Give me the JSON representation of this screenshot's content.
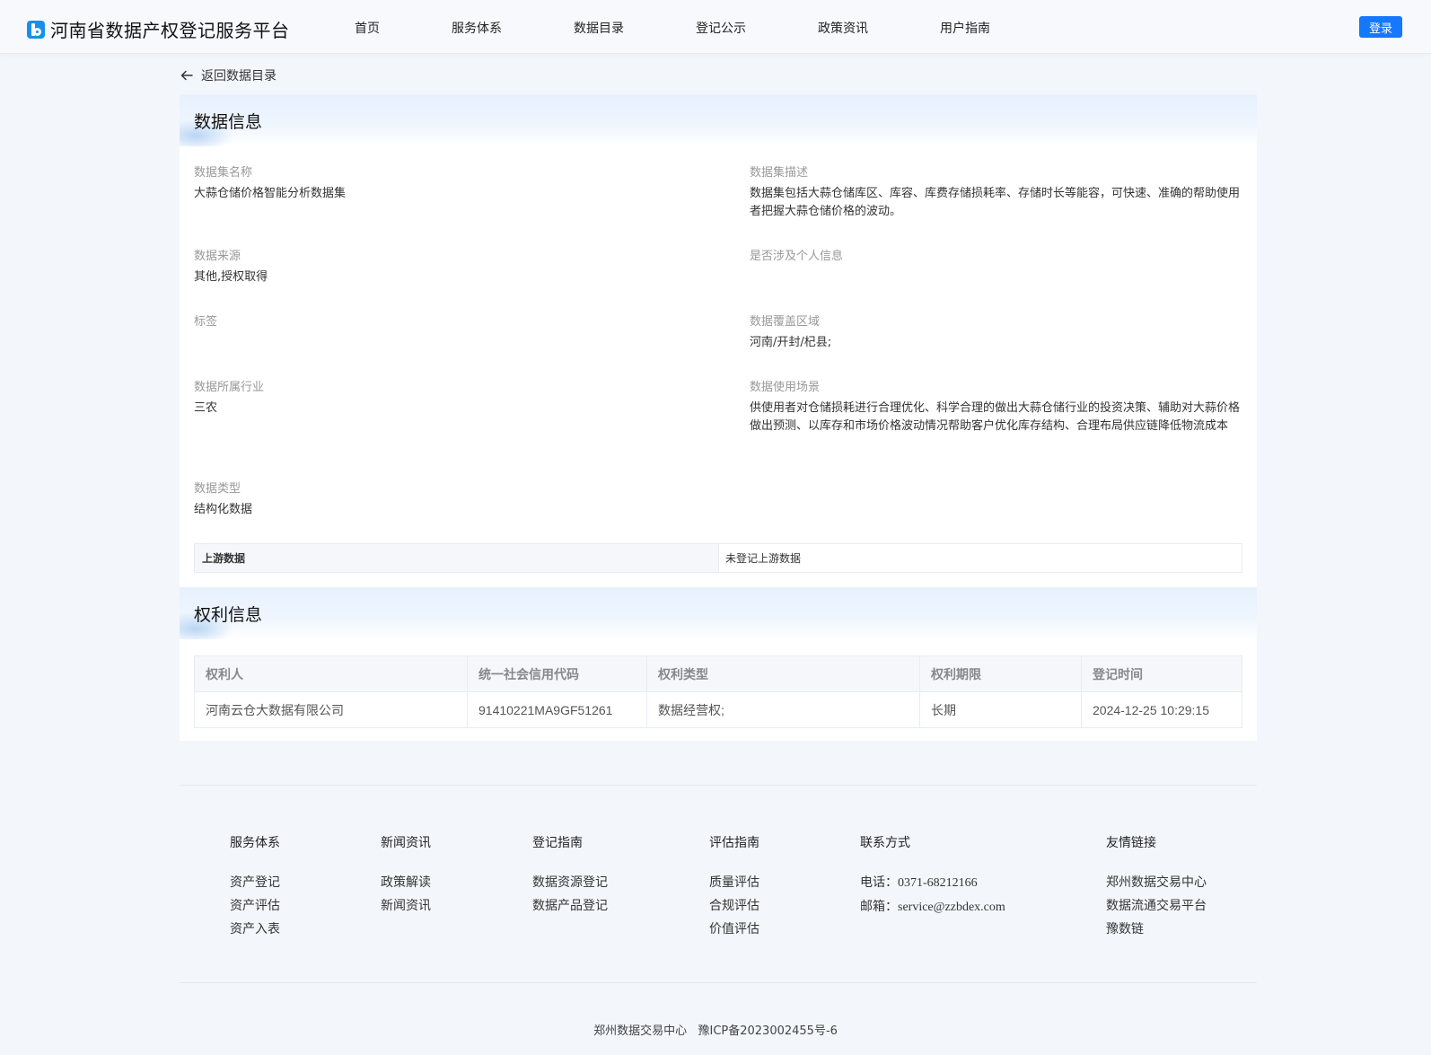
{
  "header": {
    "logo_text": "河南省数据产权登记服务平台",
    "nav": [
      "首页",
      "服务体系",
      "数据目录",
      "登记公示",
      "政策资讯",
      "用户指南"
    ],
    "login_label": "登录"
  },
  "back_label": "返回数据目录",
  "data_info": {
    "title": "数据信息",
    "fields": {
      "name": {
        "label": "数据集名称",
        "value": "大蒜仓储价格智能分析数据集"
      },
      "description": {
        "label": "数据集描述",
        "value": "数据集包括大蒜仓储库区、库容、库费存储损耗率、存储时长等能容，可快速、准确的帮助使用者把握大蒜仓储价格的波动。"
      },
      "source": {
        "label": "数据来源",
        "value": "其他,授权取得"
      },
      "personal_info": {
        "label": "是否涉及个人信息",
        "value": ""
      },
      "tags": {
        "label": "标签",
        "value": ""
      },
      "region": {
        "label": "数据覆盖区域",
        "value": "河南/开封/杞县;"
      },
      "industry": {
        "label": "数据所属行业",
        "value": "三农"
      },
      "scenario": {
        "label": "数据使用场景",
        "value": "供使用者对仓储损耗进行合理优化、科学合理的做出大蒜仓储行业的投资决策、辅助对大蒜价格做出预测、以库存和市场价格波动情况帮助客户优化库存结构、合理布局供应链降低物流成本"
      },
      "type": {
        "label": "数据类型",
        "value": "结构化数据"
      }
    },
    "upstream": {
      "label": "上游数据",
      "value": "未登记上游数据"
    }
  },
  "rights_info": {
    "title": "权利信息",
    "columns": [
      "权利人",
      "统一社会信用代码",
      "权利类型",
      "权利期限",
      "登记时间"
    ],
    "rows": [
      [
        "河南云仓大数据有限公司",
        "91410221MA9GF51261",
        "数据经营权;",
        "长期",
        "2024-12-25 10:29:15"
      ]
    ]
  },
  "footer": {
    "columns": [
      {
        "title": "服务体系",
        "items": [
          "资产登记",
          "资产评估",
          "资产入表"
        ]
      },
      {
        "title": "新闻资讯",
        "items": [
          "政策解读",
          "新闻资讯"
        ]
      },
      {
        "title": "登记指南",
        "items": [
          "数据资源登记",
          "数据产品登记"
        ]
      },
      {
        "title": "评估指南",
        "items": [
          "质量评估",
          "合规评估",
          "价值评估"
        ]
      },
      {
        "title": "联系方式",
        "phone_label": "电话：",
        "phone": "0371-68212166",
        "email_label": "邮箱：",
        "email": "service@zzbdex.com"
      },
      {
        "title": "友情链接",
        "items": [
          "郑州数据交易中心",
          "数据流通交易平台",
          "豫数链"
        ]
      }
    ],
    "copyright_org": "郑州数据交易中心",
    "icp": "豫ICP备2023002455号-6"
  },
  "colors": {
    "accent": "#1677ff",
    "background": "#f3f7fc"
  }
}
